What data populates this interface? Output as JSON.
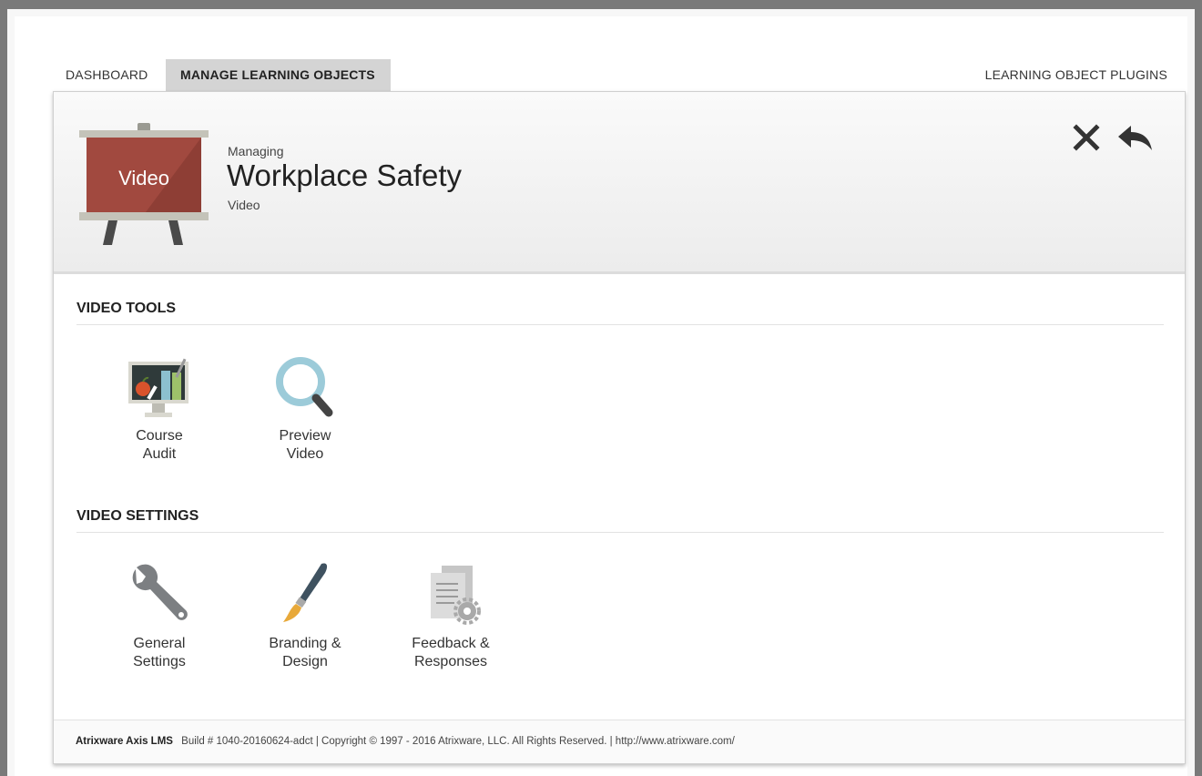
{
  "tabs": {
    "dashboard": "DASHBOARD",
    "manage": "MANAGE LEARNING OBJECTS",
    "plugins": "LEARNING OBJECT PLUGINS"
  },
  "header": {
    "easel_label": "Video",
    "managing": "Managing",
    "title": "Workplace Safety",
    "type": "Video",
    "close_icon": "close-icon",
    "back_icon": "reply-back-icon"
  },
  "video_tools": {
    "title": "VIDEO TOOLS",
    "items": [
      {
        "line1": "Course",
        "line2": "Audit",
        "icon": "course-audit-icon"
      },
      {
        "line1": "Preview",
        "line2": "Video",
        "icon": "magnifier-icon"
      }
    ]
  },
  "video_settings": {
    "title": "VIDEO SETTINGS",
    "items": [
      {
        "line1": "General",
        "line2": "Settings",
        "icon": "wrench-icon"
      },
      {
        "line1": "Branding &",
        "line2": "Design",
        "icon": "paintbrush-icon"
      },
      {
        "line1": "Feedback &",
        "line2": "Responses",
        "icon": "documents-gear-icon"
      }
    ]
  },
  "footer": {
    "product": "Atrixware Axis LMS",
    "build": "Build # 1040-20160624-adct | Copyright © 1997 - 2016 Atrixware, LLC. All Rights Reserved. |",
    "url": "http://www.atrixware.com/"
  },
  "colors": {
    "easel_board": "#a1493f",
    "tab_active_bg": "#d4d4d4",
    "preview_ring": "#9ccbd9"
  }
}
